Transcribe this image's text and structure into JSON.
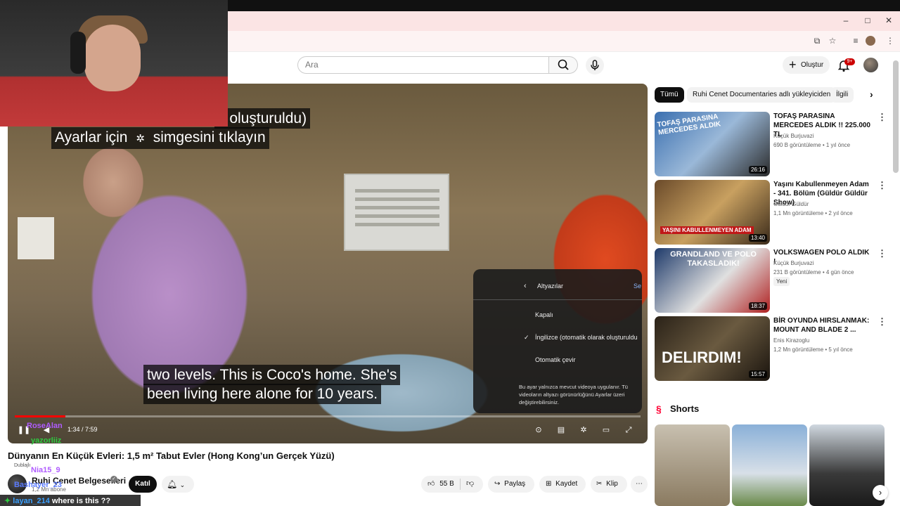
{
  "header": {
    "search_placeholder": "Ara",
    "create_label": "Oluştur",
    "notif_count": "9+"
  },
  "video": {
    "caption_top": "k oluşturuldu)",
    "caption_hint": "Ayarlar için",
    "caption_hint2": "simgesini tıklayın",
    "subtitle_line1": "two levels. This is Coco's home. She's",
    "subtitle_line2": "been living here alone for 10 years.",
    "time": "1:34 / 7:59",
    "settings": {
      "header": "Altyazılar",
      "header_right": "Se",
      "items": [
        "Kapalı",
        "İngilizce (otomatik olarak oluşturuldu",
        "Otomatik çevir"
      ],
      "footer": "Bu ayar yalnızca mevcut videoya uygulanır. Tü videoların altyazı görünürlüğünü Ayarlar üzeri değiştirebilirsiniz."
    }
  },
  "meta": {
    "title": "Dünyanın En Küçük Evleri: 1,5 m² Tabut Evler (Hong Kong’un Gerçek Yüzü)",
    "dubbed": "Dublajlı",
    "channel": "Ruhi Çenet Belgeselleri",
    "subs": "1,2 Mn abone",
    "join": "Katıl",
    "likes": "55 B",
    "share": "Paylaş",
    "save": "Kaydet",
    "clip": "Klip"
  },
  "chat": [
    {
      "user": "RoseAlan",
      "color": "#b05cff",
      "text": ""
    },
    {
      "user": "yazorliiz",
      "color": "#2ecc40",
      "text": ""
    },
    {
      "user": "Nia15_9",
      "color": "#b05cff",
      "text": ""
    },
    {
      "user": "Bashayer_23",
      "color": "#5a7bff",
      "text": ""
    },
    {
      "user": "layan_214",
      "color": "#3aa0ff",
      "text": "where is this ??"
    }
  ],
  "chips": [
    "Tümü",
    "Ruhi Cenet Documentaries adlı yükleyiciden",
    "İlgili"
  ],
  "related": [
    {
      "title": "TOFAŞ PARASINA MERCEDES ALDIK !! 225.000 TL",
      "channel": "Küçük Burjuvazi",
      "views": "690 B görüntüleme",
      "age": "1 yıl önce",
      "duration": "26:16",
      "badge": "",
      "thumb_text": "TOFAŞ PARASINA MERCEDES ALDIK"
    },
    {
      "title": "Yaşını Kabullenmeyen Adam - 341. Bölüm (Güldür Güldür Show)",
      "channel": "Güldür Güldür",
      "views": "1,1 Mn görüntüleme",
      "age": "2 yıl önce",
      "duration": "13:40",
      "badge": "",
      "thumb_text": "YAŞINI KABULLENMEYEN ADAM"
    },
    {
      "title": "VOLKSWAGEN POLO ALDIK !",
      "channel": "Küçük Burjuvazi",
      "views": "231 B görüntüleme",
      "age": "4 gün önce",
      "duration": "18:37",
      "badge": "Yeni",
      "thumb_text": "GRANDLAND VE POLO TAKASLADIK!"
    },
    {
      "title": "BİR OYUNDA HIRSLANMAK: MOUNT AND BLADE 2 ...",
      "channel": "Enis Kirazoglu",
      "views": "1,2 Mn görüntüleme",
      "age": "5 yıl önce",
      "duration": "15:57",
      "badge": "",
      "thumb_text": "DELIRDIM!"
    }
  ],
  "shorts_label": "Shorts"
}
